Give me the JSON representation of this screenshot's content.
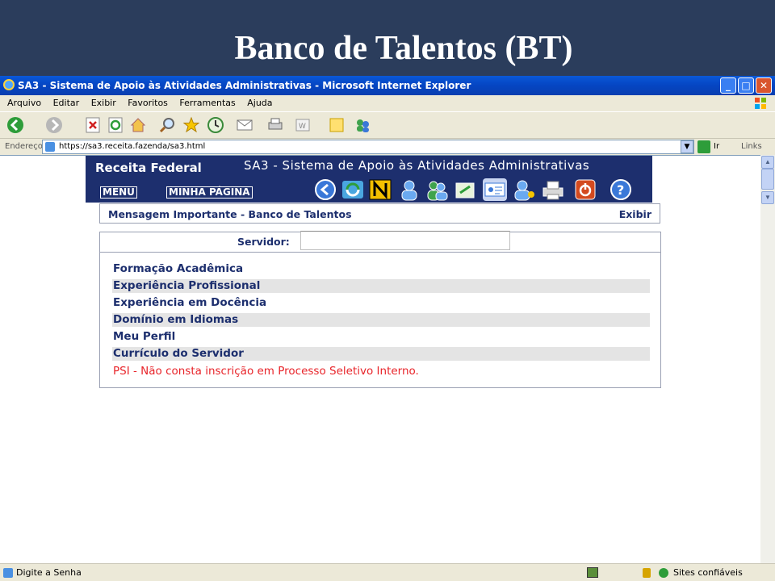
{
  "slide": {
    "title": "Banco de Talentos (BT)"
  },
  "window": {
    "title": "SA3 - Sistema de Apoio às Atividades Administrativas - Microsoft Internet Explorer",
    "controls": {
      "minimize": "_",
      "maximize": "□",
      "close": "✕"
    }
  },
  "menu": [
    "Arquivo",
    "Editar",
    "Exibir",
    "Favoritos",
    "Ferramentas",
    "Ajuda"
  ],
  "address": {
    "label": "Endereço",
    "url": "https://sa3.receita.fazenda/sa3.html",
    "go": "Ir",
    "links": "Links"
  },
  "banner": {
    "brand": "Receita Federal",
    "system_title": "SA3 - Sistema de Apoio às Atividades Administrativas",
    "menu_link": "MENU",
    "my_page_link": "MINHA PÁGINA"
  },
  "message_bar": {
    "text": "Mensagem Importante - Banco de Talentos",
    "link": "Exibir"
  },
  "panel": {
    "servidor_label": "Servidor:",
    "servidor_value": "",
    "items": [
      "Formação Acadêmica",
      "Experiência Profissional",
      "Experiência em Docência",
      "Domínio em Idiomas",
      "Meu Perfil",
      "Currículo do Servidor"
    ],
    "psi_notice": "PSI - Não consta inscrição em Processo Seletivo Interno."
  },
  "status": {
    "text": "Digite a Senha",
    "zone": "Sites confiáveis"
  }
}
